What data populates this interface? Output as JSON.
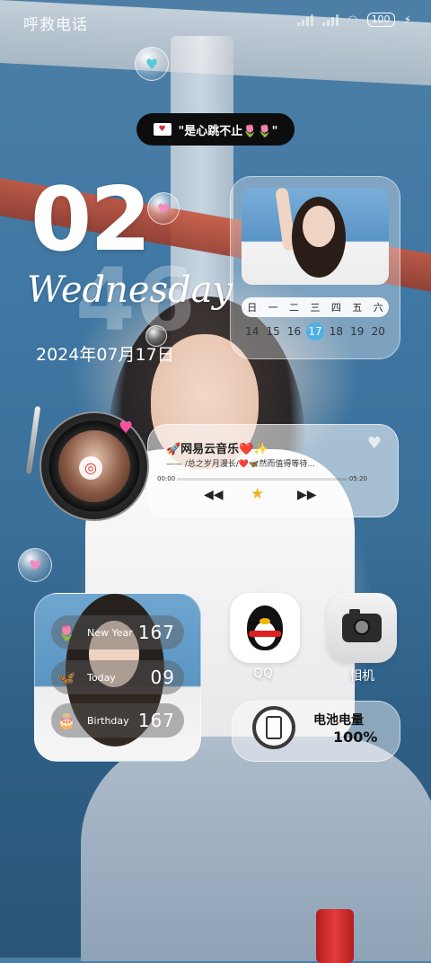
{
  "status_bar": {
    "carrier": "呼救电话",
    "battery": "100"
  },
  "notice": {
    "text": "\"是心跳不止🌷🌷\""
  },
  "clock": {
    "hour": "02",
    "minute": "46",
    "weekday": "Wednesday",
    "date": "2024年07月17日"
  },
  "calendar": {
    "weekdays": [
      "日",
      "一",
      "二",
      "三",
      "四",
      "五",
      "六"
    ],
    "days": [
      "14",
      "15",
      "16",
      "17",
      "18",
      "19",
      "20"
    ],
    "today": "17"
  },
  "music": {
    "app_title": "🚀网易云音乐❤️✨",
    "lyric": "—— /总之岁月漫长/❤️🦋然而值得等待...",
    "time_elapsed": "00:00",
    "time_total": "05:20",
    "progress": 0,
    "prev_icon": "rewind-icon",
    "play_icon": "star-icon",
    "next_icon": "fast-forward-icon"
  },
  "countdown": {
    "rows": [
      {
        "icon": "🌷",
        "label": "New Year",
        "value": "167"
      },
      {
        "icon": "🦋",
        "label": "Today",
        "value": "09"
      },
      {
        "icon": "🎂",
        "label": "Birthday",
        "value": "167"
      }
    ]
  },
  "apps": {
    "qq": "QQ",
    "camera": "相机"
  },
  "battery_widget": {
    "label": "电池电量",
    "value": "100%"
  },
  "colors": {
    "accent_today": "#4fb0e6",
    "pill_bg": "#0d0d0d"
  }
}
